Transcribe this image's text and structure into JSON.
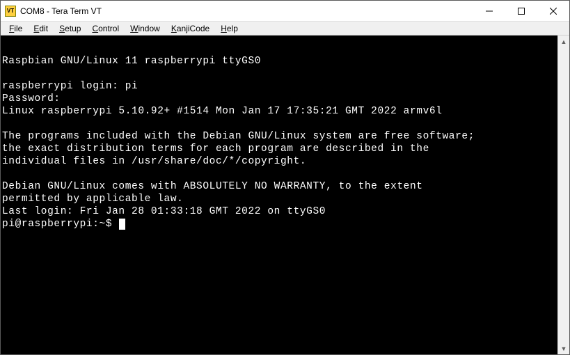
{
  "window": {
    "title": "COM8 - Tera Term VT",
    "icon_label": "VT"
  },
  "menu": {
    "file": "File",
    "edit": "Edit",
    "setup": "Setup",
    "control": "Control",
    "window": "Window",
    "kanjicode": "KanjiCode",
    "help": "Help"
  },
  "terminal": {
    "lines": [
      "",
      "Raspbian GNU/Linux 11 raspberrypi ttyGS0",
      "",
      "raspberrypi login: pi",
      "Password:",
      "Linux raspberrypi 5.10.92+ #1514 Mon Jan 17 17:35:21 GMT 2022 armv6l",
      "",
      "The programs included with the Debian GNU/Linux system are free software;",
      "the exact distribution terms for each program are described in the",
      "individual files in /usr/share/doc/*/copyright.",
      "",
      "Debian GNU/Linux comes with ABSOLUTELY NO WARRANTY, to the extent",
      "permitted by applicable law.",
      "Last login: Fri Jan 28 01:33:18 GMT 2022 on ttyGS0"
    ],
    "prompt": "pi@raspberrypi:~$ "
  }
}
